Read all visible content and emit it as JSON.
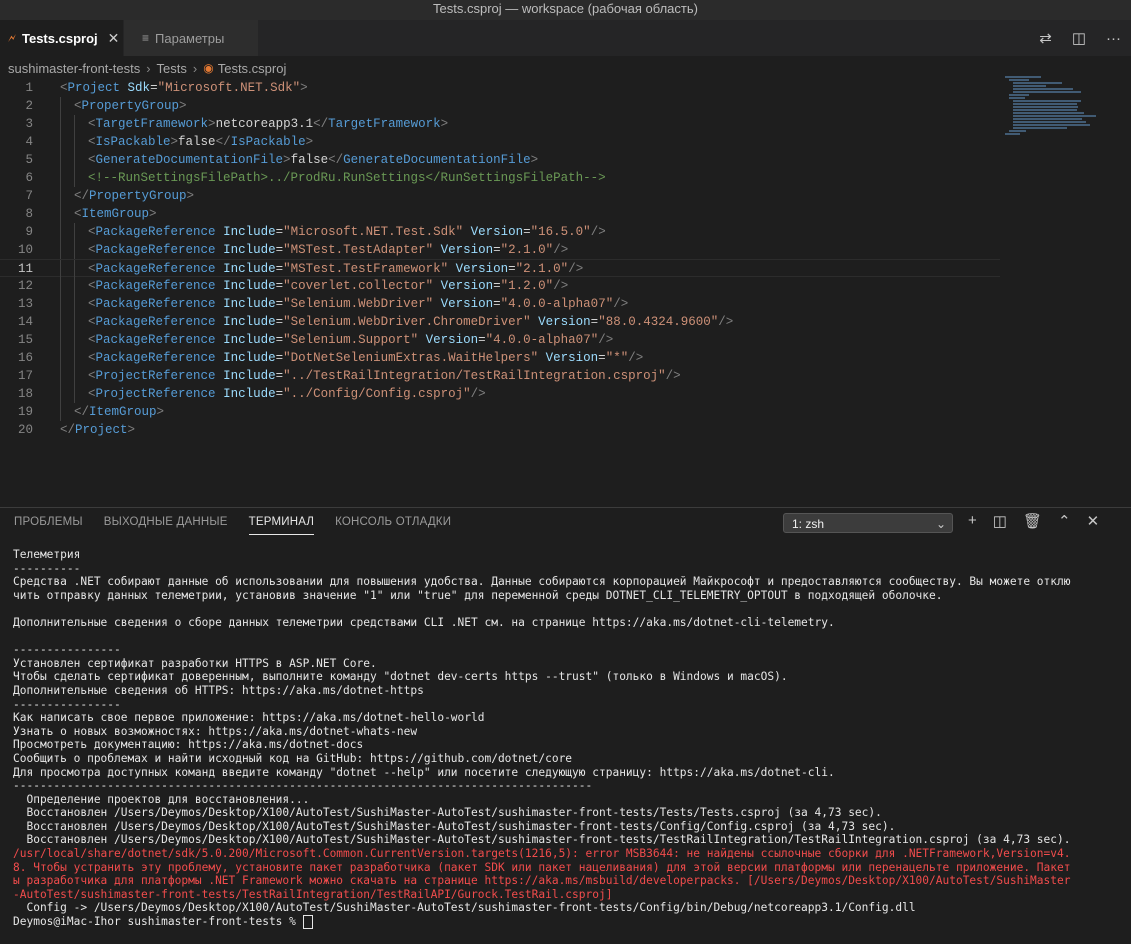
{
  "window": {
    "title": "Tests.csproj — workspace (рабочая область)"
  },
  "tabs": [
    {
      "label": "Tests.csproj",
      "active": true
    },
    {
      "label": "Параметры",
      "active": false
    }
  ],
  "breadcrumb": [
    "sushimaster-front-tests",
    "Tests",
    "Tests.csproj"
  ],
  "editor": {
    "current_line": 11,
    "lines": [
      {
        "n": "1",
        "indent": 0,
        "t": [
          [
            "tg",
            "<"
          ],
          [
            "tn",
            "Project"
          ],
          [
            "tx",
            " "
          ],
          [
            "at",
            "Sdk"
          ],
          [
            "tx",
            "="
          ],
          [
            "st",
            "\"Microsoft.NET.Sdk\""
          ],
          [
            "tg",
            ">"
          ]
        ]
      },
      {
        "n": "2",
        "indent": 1,
        "t": [
          [
            "tg",
            "<"
          ],
          [
            "tn",
            "PropertyGroup"
          ],
          [
            "tg",
            ">"
          ]
        ]
      },
      {
        "n": "3",
        "indent": 2,
        "t": [
          [
            "tg",
            "<"
          ],
          [
            "tn",
            "TargetFramework"
          ],
          [
            "tg",
            ">"
          ],
          [
            "tx",
            "netcoreapp3.1"
          ],
          [
            "tg",
            "</"
          ],
          [
            "tn",
            "TargetFramework"
          ],
          [
            "tg",
            ">"
          ]
        ]
      },
      {
        "n": "4",
        "indent": 2,
        "t": [
          [
            "tg",
            "<"
          ],
          [
            "tn",
            "IsPackable"
          ],
          [
            "tg",
            ">"
          ],
          [
            "tx",
            "false"
          ],
          [
            "tg",
            "</"
          ],
          [
            "tn",
            "IsPackable"
          ],
          [
            "tg",
            ">"
          ]
        ]
      },
      {
        "n": "5",
        "indent": 2,
        "t": [
          [
            "tg",
            "<"
          ],
          [
            "tn",
            "GenerateDocumentationFile"
          ],
          [
            "tg",
            ">"
          ],
          [
            "tx",
            "false"
          ],
          [
            "tg",
            "</"
          ],
          [
            "tn",
            "GenerateDocumentationFile"
          ],
          [
            "tg",
            ">"
          ]
        ]
      },
      {
        "n": "6",
        "indent": 2,
        "t": [
          [
            "cm",
            "<!--RunSettingsFilePath>../ProdRu.RunSettings</RunSettingsFilePath-->"
          ]
        ]
      },
      {
        "n": "7",
        "indent": 1,
        "t": [
          [
            "tg",
            "</"
          ],
          [
            "tn",
            "PropertyGroup"
          ],
          [
            "tg",
            ">"
          ]
        ]
      },
      {
        "n": "8",
        "indent": 1,
        "t": [
          [
            "tg",
            "<"
          ],
          [
            "tn",
            "ItemGroup"
          ],
          [
            "tg",
            ">"
          ]
        ]
      },
      {
        "n": "9",
        "indent": 2,
        "t": [
          [
            "tg",
            "<"
          ],
          [
            "tn",
            "PackageReference"
          ],
          [
            "tx",
            " "
          ],
          [
            "at",
            "Include"
          ],
          [
            "tx",
            "="
          ],
          [
            "st",
            "\"Microsoft.NET.Test.Sdk\""
          ],
          [
            "tx",
            " "
          ],
          [
            "at",
            "Version"
          ],
          [
            "tx",
            "="
          ],
          [
            "st",
            "\"16.5.0\""
          ],
          [
            "tg",
            "/>"
          ]
        ]
      },
      {
        "n": "10",
        "indent": 2,
        "t": [
          [
            "tg",
            "<"
          ],
          [
            "tn",
            "PackageReference"
          ],
          [
            "tx",
            " "
          ],
          [
            "at",
            "Include"
          ],
          [
            "tx",
            "="
          ],
          [
            "st",
            "\"MSTest.TestAdapter\""
          ],
          [
            "tx",
            " "
          ],
          [
            "at",
            "Version"
          ],
          [
            "tx",
            "="
          ],
          [
            "st",
            "\"2.1.0\""
          ],
          [
            "tg",
            "/>"
          ]
        ]
      },
      {
        "n": "11",
        "indent": 2,
        "t": [
          [
            "tg",
            "<"
          ],
          [
            "tn",
            "PackageReference"
          ],
          [
            "tx",
            " "
          ],
          [
            "at",
            "Include"
          ],
          [
            "tx",
            "="
          ],
          [
            "st",
            "\"MSTest.TestFramework\""
          ],
          [
            "tx",
            " "
          ],
          [
            "at",
            "Version"
          ],
          [
            "tx",
            "="
          ],
          [
            "st",
            "\"2.1.0\""
          ],
          [
            "tg",
            "/>"
          ]
        ]
      },
      {
        "n": "12",
        "indent": 2,
        "t": [
          [
            "tg",
            "<"
          ],
          [
            "tn",
            "PackageReference"
          ],
          [
            "tx",
            " "
          ],
          [
            "at",
            "Include"
          ],
          [
            "tx",
            "="
          ],
          [
            "st",
            "\"coverlet.collector\""
          ],
          [
            "tx",
            " "
          ],
          [
            "at",
            "Version"
          ],
          [
            "tx",
            "="
          ],
          [
            "st",
            "\"1.2.0\""
          ],
          [
            "tg",
            "/>"
          ]
        ]
      },
      {
        "n": "13",
        "indent": 2,
        "t": [
          [
            "tg",
            "<"
          ],
          [
            "tn",
            "PackageReference"
          ],
          [
            "tx",
            " "
          ],
          [
            "at",
            "Include"
          ],
          [
            "tx",
            "="
          ],
          [
            "st",
            "\"Selenium.WebDriver\""
          ],
          [
            "tx",
            " "
          ],
          [
            "at",
            "Version"
          ],
          [
            "tx",
            "="
          ],
          [
            "st",
            "\"4.0.0-alpha07\""
          ],
          [
            "tg",
            "/>"
          ]
        ]
      },
      {
        "n": "14",
        "indent": 2,
        "t": [
          [
            "tg",
            "<"
          ],
          [
            "tn",
            "PackageReference"
          ],
          [
            "tx",
            " "
          ],
          [
            "at",
            "Include"
          ],
          [
            "tx",
            "="
          ],
          [
            "st",
            "\"Selenium.WebDriver.ChromeDriver\""
          ],
          [
            "tx",
            " "
          ],
          [
            "at",
            "Version"
          ],
          [
            "tx",
            "="
          ],
          [
            "st",
            "\"88.0.4324.9600\""
          ],
          [
            "tg",
            "/>"
          ]
        ]
      },
      {
        "n": "15",
        "indent": 2,
        "t": [
          [
            "tg",
            "<"
          ],
          [
            "tn",
            "PackageReference"
          ],
          [
            "tx",
            " "
          ],
          [
            "at",
            "Include"
          ],
          [
            "tx",
            "="
          ],
          [
            "st",
            "\"Selenium.Support\""
          ],
          [
            "tx",
            " "
          ],
          [
            "at",
            "Version"
          ],
          [
            "tx",
            "="
          ],
          [
            "st",
            "\"4.0.0-alpha07\""
          ],
          [
            "tg",
            "/>"
          ]
        ]
      },
      {
        "n": "16",
        "indent": 2,
        "t": [
          [
            "tg",
            "<"
          ],
          [
            "tn",
            "PackageReference"
          ],
          [
            "tx",
            " "
          ],
          [
            "at",
            "Include"
          ],
          [
            "tx",
            "="
          ],
          [
            "st",
            "\"DotNetSeleniumExtras.WaitHelpers\""
          ],
          [
            "tx",
            " "
          ],
          [
            "at",
            "Version"
          ],
          [
            "tx",
            "="
          ],
          [
            "st",
            "\"*\""
          ],
          [
            "tg",
            "/>"
          ]
        ]
      },
      {
        "n": "17",
        "indent": 2,
        "t": [
          [
            "tg",
            "<"
          ],
          [
            "tn",
            "ProjectReference"
          ],
          [
            "tx",
            " "
          ],
          [
            "at",
            "Include"
          ],
          [
            "tx",
            "="
          ],
          [
            "st",
            "\"../TestRailIntegration/TestRailIntegration.csproj\""
          ],
          [
            "tg",
            "/>"
          ]
        ]
      },
      {
        "n": "18",
        "indent": 2,
        "t": [
          [
            "tg",
            "<"
          ],
          [
            "tn",
            "ProjectReference"
          ],
          [
            "tx",
            " "
          ],
          [
            "at",
            "Include"
          ],
          [
            "tx",
            "="
          ],
          [
            "st",
            "\"../Config/Config.csproj\""
          ],
          [
            "tg",
            "/>"
          ]
        ]
      },
      {
        "n": "19",
        "indent": 1,
        "t": [
          [
            "tg",
            "</"
          ],
          [
            "tn",
            "ItemGroup"
          ],
          [
            "tg",
            ">"
          ]
        ]
      },
      {
        "n": "20",
        "indent": 0,
        "t": [
          [
            "tg",
            "</"
          ],
          [
            "tn",
            "Project"
          ],
          [
            "tg",
            ">"
          ]
        ]
      }
    ]
  },
  "panel": {
    "tabs": [
      {
        "label": "ПРОБЛЕМЫ",
        "active": false
      },
      {
        "label": "ВЫХОДНЫЕ ДАННЫЕ",
        "active": false
      },
      {
        "label": "ТЕРМИНАЛ",
        "active": true
      },
      {
        "label": "КОНСОЛЬ ОТЛАДКИ",
        "active": false
      }
    ],
    "terminal_select": "1: zsh",
    "terminal_lines": [
      {
        "text": "Телеметрия",
        "red": false
      },
      {
        "text": "----------",
        "red": false
      },
      {
        "text": "Средства .NET собирают данные об использовании для повышения удобства. Данные собираются корпорацией Майкрософт и предоставляются сообществу. Вы можете отклю",
        "red": false
      },
      {
        "text": "чить отправку данных телеметрии, установив значение \"1\" или \"true\" для переменной среды DOTNET_CLI_TELEMETRY_OPTOUT в подходящей оболочке.",
        "red": false
      },
      {
        "text": "",
        "red": false
      },
      {
        "text": "Дополнительные сведения о сборе данных телеметрии средствами CLI .NET см. на странице https://aka.ms/dotnet-cli-telemetry.",
        "red": false
      },
      {
        "text": "",
        "red": false
      },
      {
        "text": "----------------",
        "red": false
      },
      {
        "text": "Установлен сертификат разработки HTTPS в ASP.NET Core.",
        "red": false
      },
      {
        "text": "Чтобы сделать сертификат доверенным, выполните команду \"dotnet dev-certs https --trust\" (только в Windows и macOS).",
        "red": false
      },
      {
        "text": "Дополнительные сведения об HTTPS: https://aka.ms/dotnet-https",
        "red": false
      },
      {
        "text": "----------------",
        "red": false
      },
      {
        "text": "Как написать свое первое приложение: https://aka.ms/dotnet-hello-world",
        "red": false
      },
      {
        "text": "Узнать о новых возможностях: https://aka.ms/dotnet-whats-new",
        "red": false
      },
      {
        "text": "Просмотреть документацию: https://aka.ms/dotnet-docs",
        "red": false
      },
      {
        "text": "Сообщить о проблемах и найти исходный код на GitHub: https://github.com/dotnet/core",
        "red": false
      },
      {
        "text": "Для просмотра доступных команд введите команду \"dotnet --help\" или посетите следующую страницу: https://aka.ms/dotnet-cli.",
        "red": false
      },
      {
        "text": "--------------------------------------------------------------------------------------",
        "red": false
      },
      {
        "text": "  Определение проектов для восстановления...",
        "red": false
      },
      {
        "text": "  Восстановлен /Users/Deymos/Desktop/X100/AutoTest/SushiMaster-AutoTest/sushimaster-front-tests/Tests/Tests.csproj (за 4,73 sec).",
        "red": false
      },
      {
        "text": "  Восстановлен /Users/Deymos/Desktop/X100/AutoTest/SushiMaster-AutoTest/sushimaster-front-tests/Config/Config.csproj (за 4,73 sec).",
        "red": false
      },
      {
        "text": "  Восстановлен /Users/Deymos/Desktop/X100/AutoTest/SushiMaster-AutoTest/sushimaster-front-tests/TestRailIntegration/TestRailIntegration.csproj (за 4,73 sec).",
        "red": false
      },
      {
        "text": "/usr/local/share/dotnet/sdk/5.0.200/Microsoft.Common.CurrentVersion.targets(1216,5): error MSB3644: не найдены ссылочные сборки для .NETFramework,Version=v4.",
        "red": true
      },
      {
        "text": "8. Чтобы устранить эту проблему, установите пакет разработчика (пакет SDK или пакет нацеливания) для этой версии платформы или перенацельте приложение. Пакет",
        "red": true
      },
      {
        "text": "ы разработчика для платформы .NET Framework можно скачать на странице https://aka.ms/msbuild/developerpacks. [/Users/Deymos/Desktop/X100/AutoTest/SushiMaster",
        "red": true
      },
      {
        "text": "-AutoTest/sushimaster-front-tests/TestRailIntegration/TestRailAPI/Gurock.TestRail.csproj]",
        "red": true
      },
      {
        "text": "  Config -> /Users/Deymos/Desktop/X100/AutoTest/SushiMaster-AutoTest/sushimaster-front-tests/Config/bin/Debug/netcoreapp3.1/Config.dll",
        "red": false
      }
    ],
    "prompt": "Deymos@iMac-Ihor sushimaster-front-tests % "
  }
}
